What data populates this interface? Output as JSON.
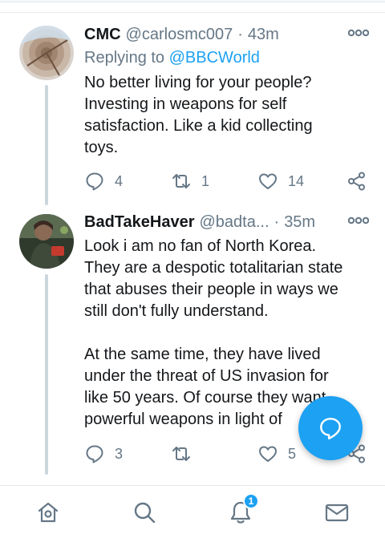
{
  "tweets": [
    {
      "name": "CMC",
      "handle": "@carlosmc007",
      "separator": "·",
      "time": "43m",
      "replying_prefix": "Replying to ",
      "replying_to": "@BBCWorld",
      "text": "No better living for your people?\nInvesting in weapons for self\nsatisfaction. Like a kid collecting\ntoys.",
      "replies": "4",
      "retweets": "1",
      "likes": "14"
    },
    {
      "name": "BadTakeHaver",
      "handle": "@badta...",
      "separator": "·",
      "time": "35m",
      "text": "Look i am no fan of North Korea.\nThey are a despotic totalitarian state\nthat abuses their people in ways we\nstill don't fully understand.\n\nAt the same time, they have lived\nunder the threat of US invasion for\nlike 50 years. Of course they want\npowerful weapons in light of",
      "replies": "3",
      "retweets": "",
      "likes": "5"
    }
  ],
  "bottom_nav": {
    "items": [
      "home-icon",
      "search-icon",
      "notifications-icon",
      "messages-icon"
    ],
    "notification_badge": "1"
  },
  "colors": {
    "accent": "#1da1f2",
    "secondary_text": "#657786",
    "thread_line": "#ccd6dd"
  }
}
